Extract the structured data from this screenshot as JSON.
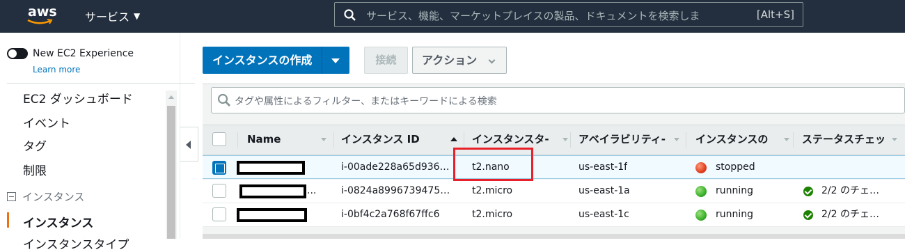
{
  "topbar": {
    "logo_text": "aws",
    "services_label": "サービス",
    "search_placeholder": "サービス、機能、マーケットプレイスの製品、ドキュメントを検索しま",
    "search_shortcut": "[Alt+S]"
  },
  "sidebar": {
    "toggle_label": "New EC2 Experience",
    "learn_more": "Learn more",
    "items": [
      "EC2 ダッシュボード",
      "イベント",
      "タグ",
      "制限"
    ],
    "section": "インスタンス",
    "active_item": "インスタンス",
    "clipped_item": "インスタンスタイプ"
  },
  "toolbar": {
    "create_label": "インスタンスの作成",
    "connect_label": "接続",
    "actions_label": "アクション"
  },
  "filter": {
    "placeholder": "タグや属性によるフィルター、またはキーワードによる検索"
  },
  "table": {
    "columns": [
      "Name",
      "インスタンス ID",
      "インスタンスタ-",
      "アベイラビリティ-",
      "インスタンスの",
      "ステータスチェッ"
    ],
    "rows": [
      {
        "name": "",
        "id": "i-00ade228a65d936…",
        "type": "t2.nano",
        "az": "us-east-1f",
        "state": "stopped",
        "state_color": "#e0401f",
        "check": "",
        "selected": true
      },
      {
        "name": "",
        "id": "i-0824a8996739475…",
        "type": "t2.micro",
        "az": "us-east-1a",
        "state": "running",
        "state_color": "#3bb02c",
        "check": "2/2 のチェ…",
        "selected": false
      },
      {
        "name": "",
        "id": "i-0bf4c2a768f67ffc6",
        "type": "t2.micro",
        "az": "us-east-1c",
        "state": "running",
        "state_color": "#3bb02c",
        "check": "2/2 のチェ…",
        "selected": false
      }
    ],
    "row1_name_suffix": "..."
  },
  "colors": {
    "nav_bg": "#232f3e",
    "primary": "#0073bb",
    "accent": "#ec7211",
    "highlight": "#e8202a"
  }
}
